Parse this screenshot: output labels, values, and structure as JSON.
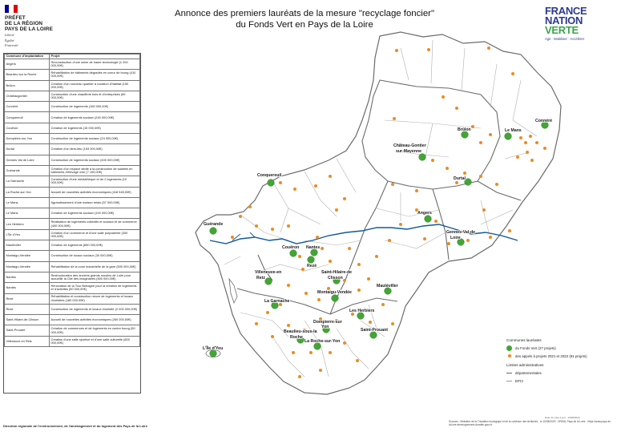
{
  "logo": {
    "title_lines": [
      "PRÉFET",
      "DE LA RÉGION",
      "PAYS DE LA LOIRE"
    ],
    "motto_lines": [
      "Liberté",
      "Égalité",
      "Fraternité"
    ],
    "flag_colors": [
      "#000091",
      "#ffffff",
      "#e1000f"
    ]
  },
  "title": {
    "line1": "Annonce des premiers lauréats de la mesure \"recyclage foncier\"",
    "line2": "du Fonds Vert en Pays de la Loire"
  },
  "fnv": {
    "line1": "FRANCE",
    "line2a": "NATION ",
    "line2b": "VERTE",
    "tagline": "Agir · Mobiliser · Accélérer"
  },
  "table": {
    "headers": [
      "Commune d'implantation",
      "Projet"
    ],
    "rows": [
      {
        "commune": "Angers",
        "projet": "Reconstruction d'une usine de haute technologie (1 200 000,00€)"
      },
      {
        "commune": "Beaulieu sur la Roche",
        "projet": "Réhabilitation de bâtiments dégradés en coeur de bourg (410 000,00€)"
      },
      {
        "commune": "Brûlon",
        "projet": "Création d'un nouveau quartier à vocation d'habitat (150 000,00€)"
      },
      {
        "commune": "Châteaugontier",
        "projet": "Construction d'une chaufferie bois et d'entreprises (69 000,00€)"
      },
      {
        "commune": "Connéré",
        "projet": "Construction de logements (160 000,00€)"
      },
      {
        "commune": "Conquereuil",
        "projet": "Création de logements sociaux (240 000,00€)"
      },
      {
        "commune": "Couëron",
        "projet": "Création de logements (15 000,00€)"
      },
      {
        "commune": "Dompierre-sur-Yon",
        "projet": "Construction de logements sociaux (24 000,00€)"
      },
      {
        "commune": "Durtal",
        "projet": "Création d'un tiers-lieu (153 000,00€)"
      },
      {
        "commune": "Gennes Val de Loire",
        "projet": "Construction de logements sociaux (400 000,00€)"
      },
      {
        "commune": "Guérande",
        "projet": "Création d'un espace dédié à la construction de salariés en bâtiments d'élevage ovin (7 100,00€)"
      },
      {
        "commune": "La Garnache",
        "projet": "Construction d'une médiathèque et de 2 logements (10 000,00€)"
      },
      {
        "commune": "La Roche-sur-Yon",
        "projet": "Accueil de nouvelles activités économiques (418 545,00€)"
      },
      {
        "commune": "Le Mans",
        "projet": "Agrandissement d'une maison relais (57 000,00€)"
      },
      {
        "commune": "Le Mans",
        "projet": "Création de logements sociaux (100 000,00€)"
      },
      {
        "commune": "Les Herbiers",
        "projet": "Réalisation de logements collectifs et sociaux et de commerce (400 000,00€)"
      },
      {
        "commune": "L'Île d'Yeu",
        "projet": "Création d'un commerce et d'une salle polyvalente (300 000,00€)"
      },
      {
        "commune": "Mauléviller",
        "projet": "Création de logements (650 000,00€)"
      },
      {
        "commune": "Montaigu-Vendée",
        "projet": "Construction de locaux sociaux (30 000,00€)"
      },
      {
        "commune": "Montaigu-Vendée",
        "projet": "Réhabilitation de la zone industrielle de la gare (500 000,00€)"
      },
      {
        "commune": "Nantes",
        "projet": "Restructuration des anciens grands moulins de Loire pour accueillir la Cité des imaginaires (500 000,00€)"
      },
      {
        "commune": "Nantes",
        "projet": "Rénovation de la Tour Bretagne pour la création de logements et d'activités (50 000,00€)"
      },
      {
        "commune": "Rezé",
        "projet": "Réhabilitation et construction neuve de logements et locaux d'activités (180 000,00€)"
      },
      {
        "commune": "Rezé",
        "projet": "Construction de logements et locaux d'activité (2 000 000,00€)"
      },
      {
        "commune": "Saint-Hilaire-de-Clisson",
        "projet": "Accueil de nouvelles activités économiques (260 000,00€)"
      },
      {
        "commune": "Saint-Prouant",
        "projet": "Création de commerces et de logements en centre bourg (50 000,00€)"
      },
      {
        "commune": "Villeneuve en Retz",
        "projet": "Création d'une salle sportive et d'une salle culturelle (600 000,00€)"
      }
    ]
  },
  "map": {
    "labels": [
      {
        "text": "Brûlon"
      },
      {
        "text": "Le Mans"
      },
      {
        "text": "Connéré"
      },
      {
        "text": "Château-Gontier"
      },
      {
        "text": "sur-Mayenne"
      },
      {
        "text": "Conquereuil"
      },
      {
        "text": "Durtal"
      },
      {
        "text": "Guérande"
      },
      {
        "text": "Angers"
      },
      {
        "text": "Gennes-Val-de"
      },
      {
        "text": "Loire"
      },
      {
        "text": "Couëron"
      },
      {
        "text": "Nantes"
      },
      {
        "text": "Rezé"
      },
      {
        "text": "Saint-Hilaire-de"
      },
      {
        "text": "Clisson"
      },
      {
        "text": "Villeneuve-en"
      },
      {
        "text": "Retz"
      },
      {
        "text": "Montaigu-Vendée"
      },
      {
        "text": "Mauléviller"
      },
      {
        "text": "La Garnache"
      },
      {
        "text": "Les Herbiers"
      },
      {
        "text": "Dompierre-sur"
      },
      {
        "text": "Yon"
      },
      {
        "text": "L'Île d'Yeu"
      },
      {
        "text": "Beaulieu-sous-la"
      },
      {
        "text": "Roche"
      },
      {
        "text": "La Roche-sur-Yon"
      },
      {
        "text": "Saint-Prouant"
      }
    ],
    "colors": {
      "laureat": "#43a535",
      "appel": "#ef8a1e",
      "boundary": "#6b6b6b",
      "epci": "#b0b0b0",
      "water": "#0f5a9a"
    }
  },
  "legend": {
    "heading1": "Communes lauréates",
    "heading2": "du Fonds Vert (27 projets)",
    "item_appels": "des appels à projets 2021 et 2022 (81 projets)",
    "limits_title": "Limites administratives",
    "item_dep": "départementales",
    "item_epci": "EPCI"
  },
  "footer": {
    "left": "Direction régionale de l'environnement, de l'aménagement et du logement des Pays de la Loire",
    "right": "Sources : Ministère de la Transition écologique et de la cohésion des territoires · le 10/08/2023 · DREAL Pays de la Loire · https://www.pays-de-la-loire.developpement-durable.gouv.fr",
    "small": "Date de mise à jour : 10/08/2023"
  }
}
